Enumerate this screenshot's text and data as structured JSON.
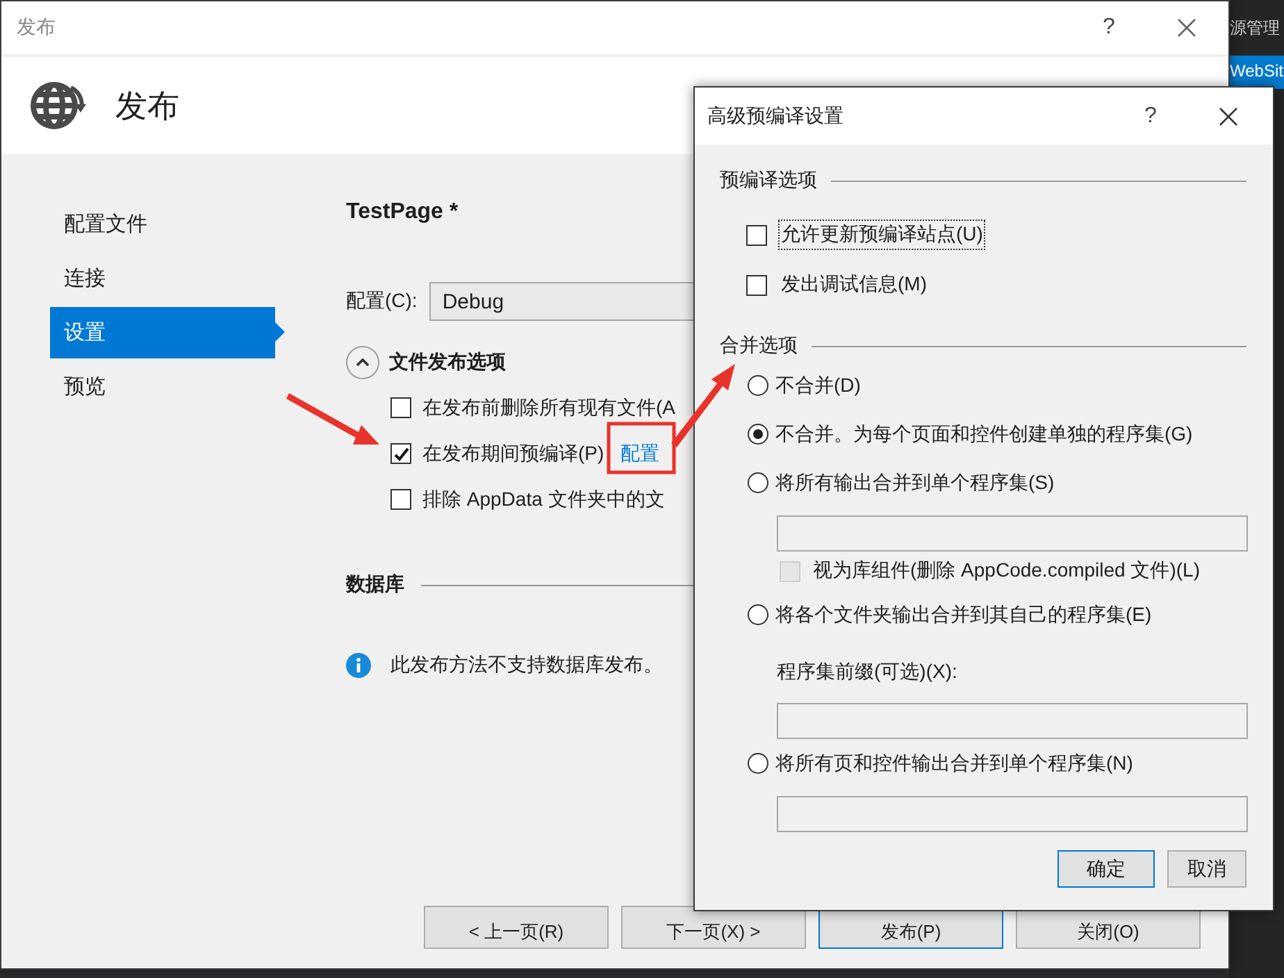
{
  "background_window": {
    "header": "源管理",
    "tab": "WebSit"
  },
  "publish": {
    "window_title": "发布",
    "help": "?",
    "header_title": "发布",
    "sidebar": [
      {
        "label": "配置文件",
        "selected": false
      },
      {
        "label": "连接",
        "selected": false
      },
      {
        "label": "设置",
        "selected": true
      },
      {
        "label": "预览",
        "selected": false
      }
    ],
    "profile": "TestPage *",
    "config": {
      "label": "配置(C):",
      "value": "Debug"
    },
    "file_options": {
      "title": "文件发布选项",
      "expanded": true,
      "items": [
        {
          "label": "在发布前删除所有现有文件(A",
          "checked": false
        },
        {
          "label": "在发布期间预编译(P)",
          "checked": true,
          "link": "配置"
        },
        {
          "label": "排除 AppData 文件夹中的文",
          "checked": false
        }
      ]
    },
    "database": {
      "title": "数据库",
      "info": "此发布方法不支持数据库发布。"
    },
    "buttons": [
      {
        "label": "< 上一页(R)",
        "default": false
      },
      {
        "label": "下一页(X) >",
        "default": false
      },
      {
        "label": "发布(P)",
        "default": true
      },
      {
        "label": "关闭(O)",
        "default": false
      }
    ]
  },
  "advanced": {
    "window_title": "高级预编译设置",
    "help": "?",
    "precompile": {
      "title": "预编译选项",
      "items": [
        {
          "label": "允许更新预编译站点(U)",
          "checked": false,
          "focused": true
        },
        {
          "label": "发出调试信息(M)",
          "checked": false,
          "focused": false
        }
      ]
    },
    "merge": {
      "title": "合并选项",
      "items": [
        {
          "kind": "radio",
          "label": "不合并(D)",
          "selected": false
        },
        {
          "kind": "radio",
          "label": "不合并。为每个页面和控件创建单独的程序集(G)",
          "selected": true
        },
        {
          "kind": "radio",
          "label": "将所有输出合并到单个程序集(S)",
          "selected": false
        },
        {
          "kind": "field"
        },
        {
          "kind": "checkbox",
          "label": "视为库组件(删除 AppCode.compiled 文件)(L)",
          "checked": false,
          "disabled": true
        },
        {
          "kind": "radio",
          "label": "将各个文件夹输出合并到其自己的程序集(E)",
          "selected": false
        },
        {
          "kind": "label",
          "label": "程序集前缀(可选)(X):"
        },
        {
          "kind": "field"
        },
        {
          "kind": "radio",
          "label": "将所有页和控件输出合并到单个程序集(N)",
          "selected": false
        },
        {
          "kind": "field"
        }
      ]
    },
    "buttons": [
      {
        "label": "确定",
        "default": true
      },
      {
        "label": "取消",
        "default": false
      }
    ]
  }
}
